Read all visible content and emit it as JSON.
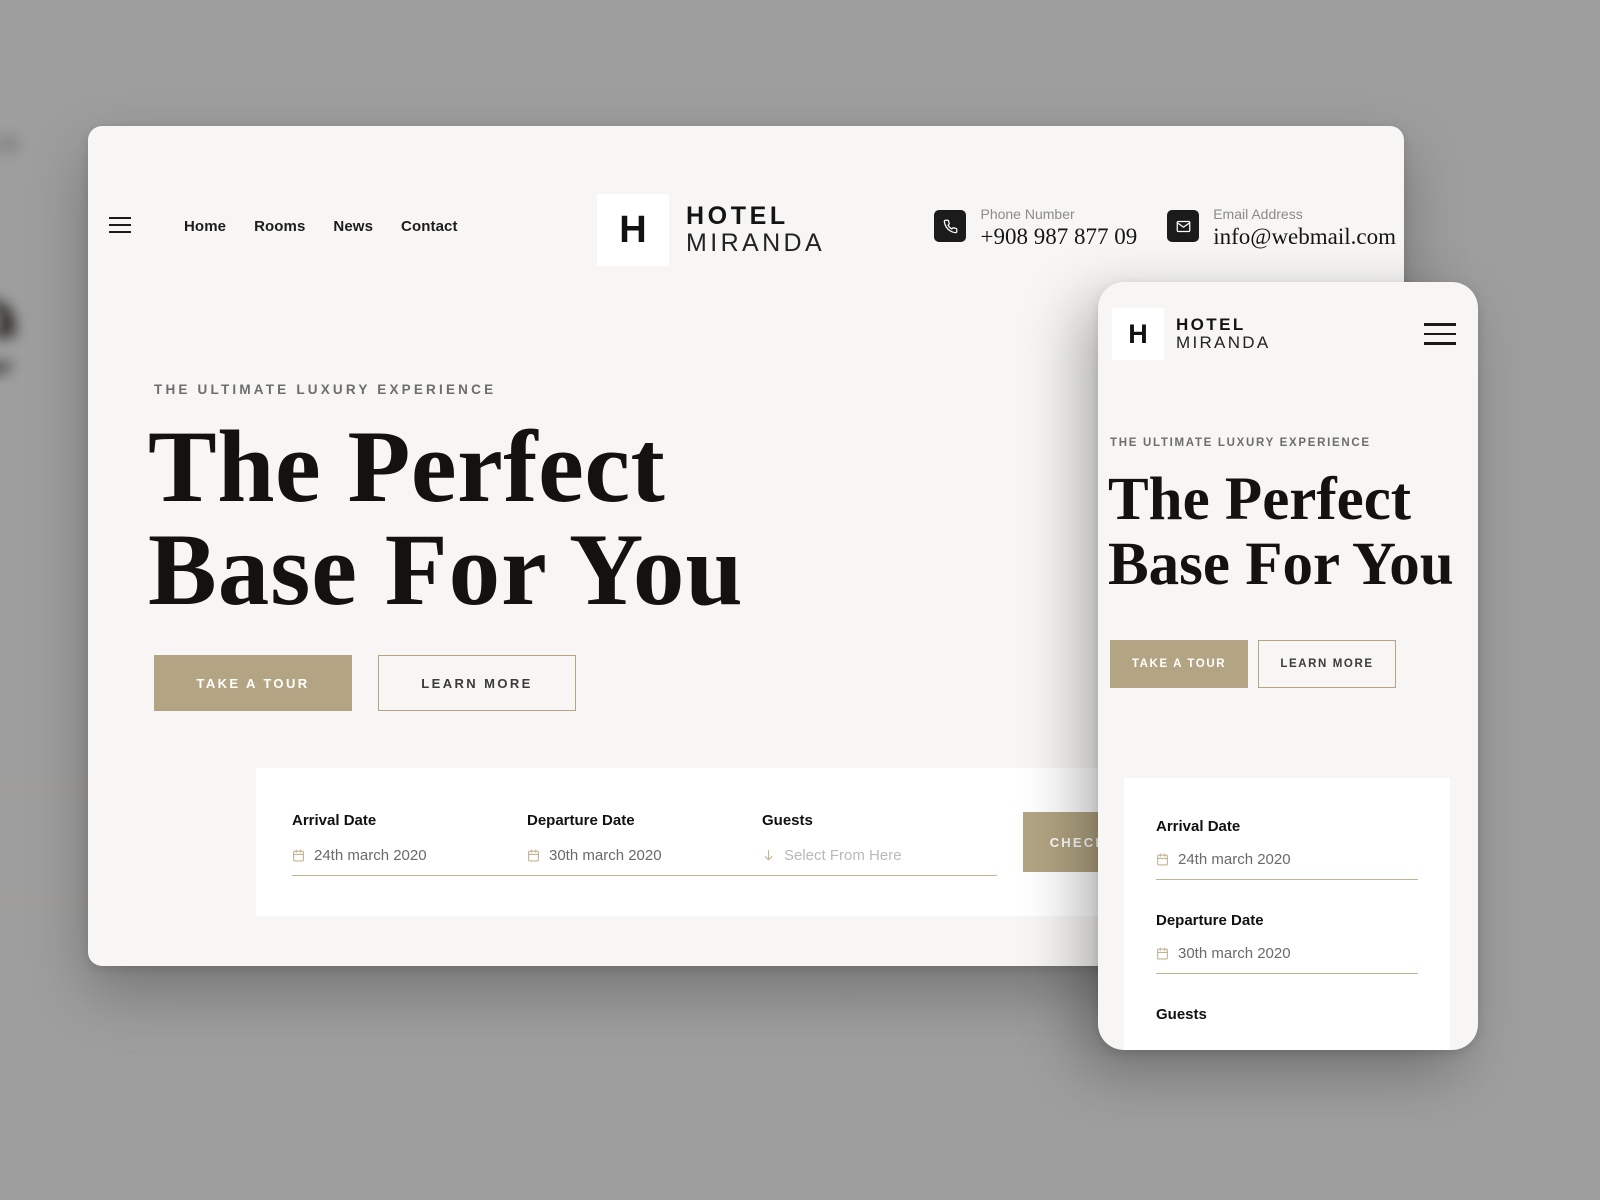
{
  "colors": {
    "page_background": "#9e9e9e",
    "device_surface": "#f7f6f4",
    "accent_tan": "#b3a583",
    "card_white": "#ffffff",
    "text_dark": "#141210",
    "text_muted": "#6d6d6d"
  },
  "brand": {
    "mark": "H",
    "name_line1": "HOTEL",
    "name_line2": "MIRANDA"
  },
  "desktop": {
    "nav": [
      {
        "label": "Home"
      },
      {
        "label": "Rooms"
      },
      {
        "label": "News"
      },
      {
        "label": "Contact"
      }
    ],
    "contacts": [
      {
        "icon": "phone-icon",
        "label": "Phone Number",
        "value": "+908 987 877 09"
      },
      {
        "icon": "envelope-icon",
        "label": "Email Address",
        "value": "info@webmail.com"
      }
    ],
    "hero": {
      "eyebrow": "THE ULTIMATE LUXURY EXPERIENCE",
      "title_line1": "The Perfect",
      "title_line2": "Base For You",
      "primary_cta": "TAKE A TOUR",
      "secondary_cta": "LEARN MORE"
    },
    "booking": {
      "fields": [
        {
          "label": "Arrival Date",
          "icon": "calendar-icon",
          "value": "24th march 2020",
          "is_placeholder": false
        },
        {
          "label": "Departure Date",
          "icon": "calendar-icon",
          "value": "30th march 2020",
          "is_placeholder": false
        },
        {
          "label": "Guests",
          "icon": "arrow-down-icon",
          "value": "Select From Here",
          "is_placeholder": true
        }
      ],
      "submit_label": "CHECK AVAILABILITY"
    }
  },
  "mobile": {
    "hero": {
      "eyebrow": "THE ULTIMATE LUXURY EXPERIENCE",
      "title_line1": "The Perfect",
      "title_line2": "Base For You",
      "primary_cta": "TAKE A TOUR",
      "secondary_cta": "LEARN MORE"
    },
    "booking": {
      "fields": [
        {
          "label": "Arrival Date",
          "icon": "calendar-icon",
          "value": "24th march 2020"
        },
        {
          "label": "Departure Date",
          "icon": "calendar-icon",
          "value": "30th march 2020"
        },
        {
          "label": "Guests",
          "icon": "",
          "value": ""
        }
      ]
    }
  },
  "background_preview": {
    "eyebrow_fragment": "NCE",
    "title_fragment_1": "fe",
    "title_fragment_2": "r",
    "cta_fragment": "ARN"
  }
}
